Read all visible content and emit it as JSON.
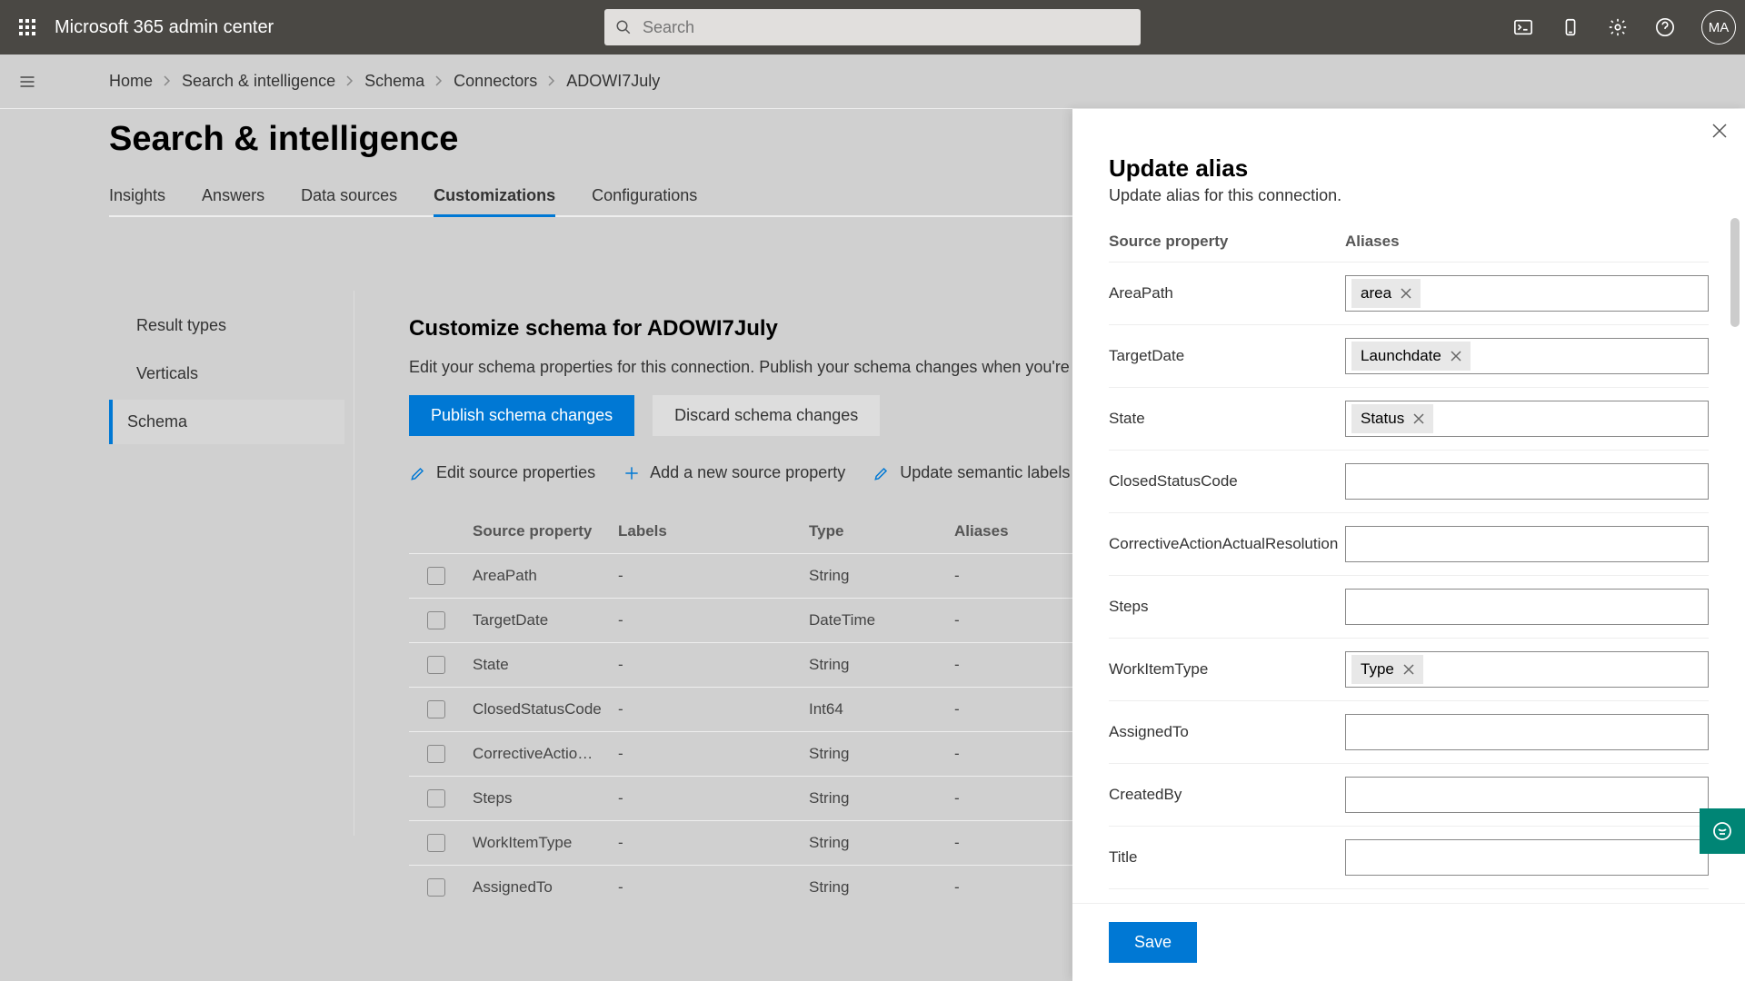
{
  "header": {
    "brand": "Microsoft 365 admin center",
    "search_placeholder": "Search",
    "avatar": "MA"
  },
  "breadcrumb": [
    "Home",
    "Search & intelligence",
    "Schema",
    "Connectors",
    "ADOWI7July"
  ],
  "page": {
    "title": "Search & intelligence"
  },
  "tabs": [
    {
      "label": "Insights"
    },
    {
      "label": "Answers"
    },
    {
      "label": "Data sources"
    },
    {
      "label": "Customizations",
      "active": true
    },
    {
      "label": "Configurations"
    }
  ],
  "leftnav": {
    "items": [
      {
        "label": "Result types"
      },
      {
        "label": "Verticals"
      },
      {
        "label": "Schema",
        "active": true
      }
    ]
  },
  "schema": {
    "title": "Customize schema for ADOWI7July",
    "desc": "Edit your schema properties for this connection. Publish your schema changes when you're done.",
    "publish": "Publish schema changes",
    "discard": "Discard schema changes",
    "actions": {
      "edit": "Edit source properties",
      "add": "Add a new source property",
      "update": "Update semantic labels"
    },
    "columns": {
      "c1": "Source property",
      "c2": "Labels",
      "c3": "Type",
      "c4": "Aliases"
    },
    "rows": [
      {
        "name": "AreaPath",
        "labels": "-",
        "type": "String",
        "aliases": "-"
      },
      {
        "name": "TargetDate",
        "labels": "-",
        "type": "DateTime",
        "aliases": "-"
      },
      {
        "name": "State",
        "labels": "-",
        "type": "String",
        "aliases": "-"
      },
      {
        "name": "ClosedStatusCode",
        "labels": "-",
        "type": "Int64",
        "aliases": "-"
      },
      {
        "name": "CorrectiveActio…",
        "labels": "-",
        "type": "String",
        "aliases": "-"
      },
      {
        "name": "Steps",
        "labels": "-",
        "type": "String",
        "aliases": "-"
      },
      {
        "name": "WorkItemType",
        "labels": "-",
        "type": "String",
        "aliases": "-"
      },
      {
        "name": "AssignedTo",
        "labels": "-",
        "type": "String",
        "aliases": "-"
      }
    ]
  },
  "panel": {
    "title": "Update alias",
    "subtitle": "Update alias for this connection.",
    "head_source": "Source property",
    "head_aliases": "Aliases",
    "rows": [
      {
        "prop": "AreaPath",
        "chips": [
          "area"
        ]
      },
      {
        "prop": "TargetDate",
        "chips": [
          "Launchdate"
        ]
      },
      {
        "prop": "State",
        "chips": [
          "Status"
        ]
      },
      {
        "prop": "ClosedStatusCode",
        "chips": []
      },
      {
        "prop": "CorrectiveActionActualResolution",
        "chips": []
      },
      {
        "prop": "Steps",
        "chips": []
      },
      {
        "prop": "WorkItemType",
        "chips": [
          "Type"
        ]
      },
      {
        "prop": "AssignedTo",
        "chips": []
      },
      {
        "prop": "CreatedBy",
        "chips": []
      },
      {
        "prop": "Title",
        "chips": []
      }
    ],
    "save": "Save"
  }
}
